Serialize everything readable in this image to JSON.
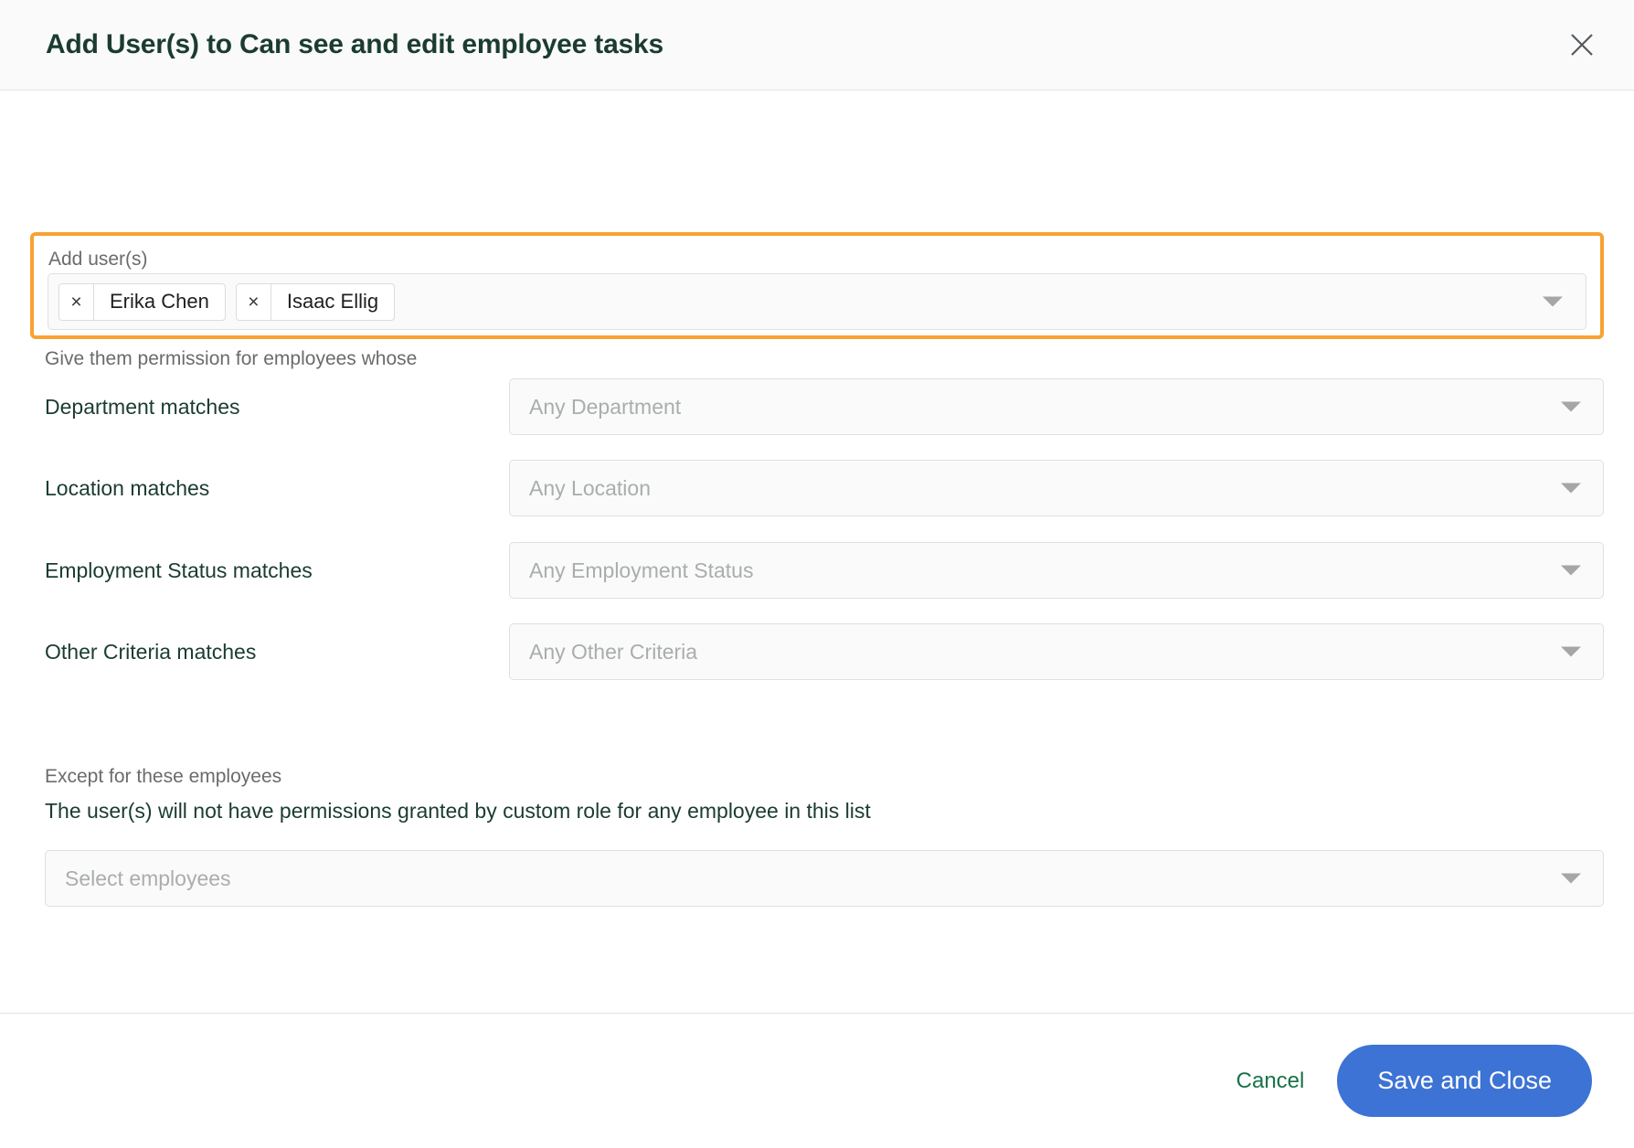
{
  "header": {
    "title": "Add User(s) to Can see and edit employee tasks",
    "close_icon": "close-icon"
  },
  "add_users": {
    "label": "Add user(s)",
    "chips": [
      {
        "name": "Erika Chen",
        "remove_glyph": "×"
      },
      {
        "name": "Isaac Ellig",
        "remove_glyph": "×"
      }
    ],
    "dropdown_icon": "chevron-down-icon",
    "highlight_color": "#f7a233"
  },
  "criteria": {
    "note": "Give them permission for employees whose",
    "rows": [
      {
        "label": "Department matches",
        "placeholder": "Any Department"
      },
      {
        "label": "Location matches",
        "placeholder": "Any Location"
      },
      {
        "label": "Employment Status matches",
        "placeholder": "Any Employment Status"
      },
      {
        "label": "Other Criteria matches",
        "placeholder": "Any Other Criteria"
      }
    ]
  },
  "exceptions": {
    "note": "Except for these employees",
    "description": "The user(s) will not have permissions granted by custom role for any employee in this list",
    "placeholder": "Select employees"
  },
  "footer": {
    "cancel_label": "Cancel",
    "save_label": "Save and Close",
    "cancel_color": "#18724a",
    "save_color": "#3c73d4"
  }
}
